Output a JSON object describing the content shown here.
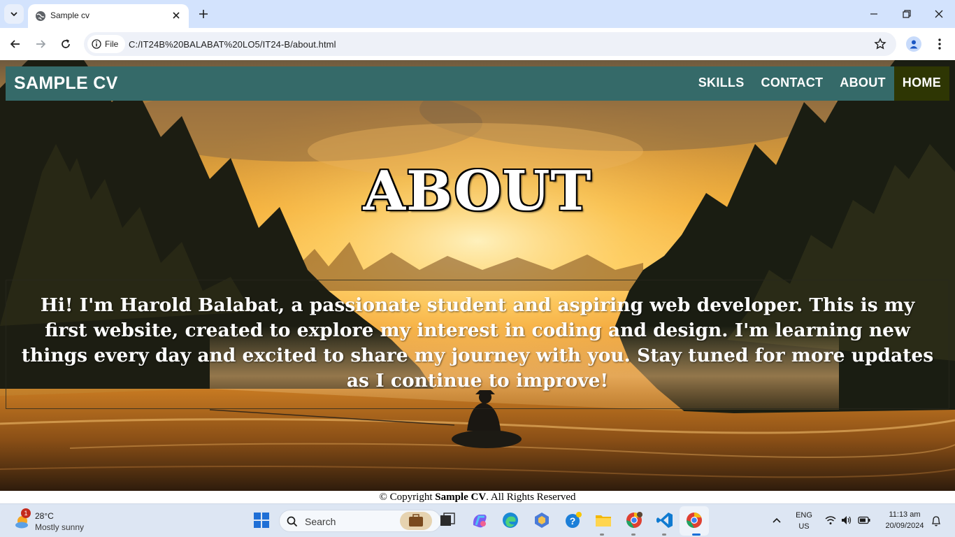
{
  "browser": {
    "tab_title": "Sample cv",
    "chip_label": "File",
    "url": "C:/IT24B%20BALABAT%20LO5/IT24-B/about.html"
  },
  "site": {
    "brand": "SAMPLE CV",
    "nav": [
      "SKILLS",
      "CONTACT",
      "ABOUT",
      "HOME"
    ],
    "active_nav": "HOME",
    "nav_color": "#356a69",
    "active_nav_color": "#2e3603",
    "heading": "ABOUT",
    "about_text": "Hi! I'm Harold Balabat, a passionate student and aspiring web developer. This is my first website, created to explore my interest in coding and design. I'm learning new things every day and excited to share my journey with you. Stay tuned for more updates as I continue to improve!",
    "footer_prefix": "© Copyright ",
    "footer_brand": "Sample CV",
    "footer_suffix": ". All Rights Reserved"
  },
  "taskbar": {
    "weather_badge": "1",
    "temperature": "28°C",
    "weather_desc": "Mostly sunny",
    "search_label": "Search",
    "lang_top": "ENG",
    "lang_bottom": "US",
    "time": "11:13 am",
    "date": "20/09/2024"
  }
}
